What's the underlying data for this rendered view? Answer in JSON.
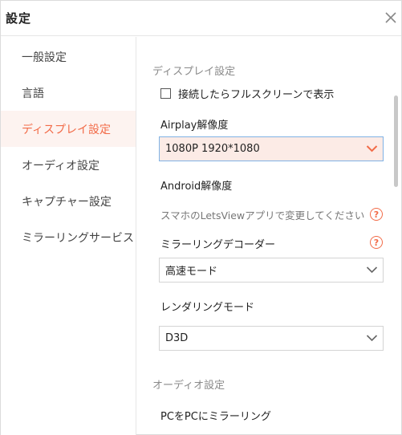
{
  "window": {
    "title": "設定"
  },
  "sidebar": {
    "items": [
      {
        "label": "一般設定",
        "active": false
      },
      {
        "label": "言語",
        "active": false
      },
      {
        "label": "ディスプレイ設定",
        "active": true
      },
      {
        "label": "オーディオ設定",
        "active": false
      },
      {
        "label": "キャプチャー設定",
        "active": false
      },
      {
        "label": "ミラーリングサービス",
        "active": false
      }
    ]
  },
  "display": {
    "section_title": "ディスプレイ設定",
    "fullscreen_checkbox": {
      "label": "接続したらフルスクリーンで表示",
      "checked": false
    },
    "airplay": {
      "label": "Airplay解像度",
      "value": "1080P 1920*1080"
    },
    "android": {
      "label": "Android解像度",
      "hint": "スマホのLetsViewアプリで変更してください"
    },
    "decoder": {
      "label": "ミラーリングデコーダー",
      "value": "高速モード"
    },
    "rendering": {
      "label": "レンダリングモード",
      "value": "D3D"
    }
  },
  "audio": {
    "section_title": "オーディオ設定",
    "pc_mirroring_label": "PCをPCにミラーリング"
  },
  "icons": {
    "help": "question-circle-icon",
    "close": "close-icon",
    "chevron": "chevron-down-icon"
  },
  "colors": {
    "accent": "#f26b48",
    "active_bg": "#fdf3f0",
    "highlight_border": "#7fb2e5"
  }
}
